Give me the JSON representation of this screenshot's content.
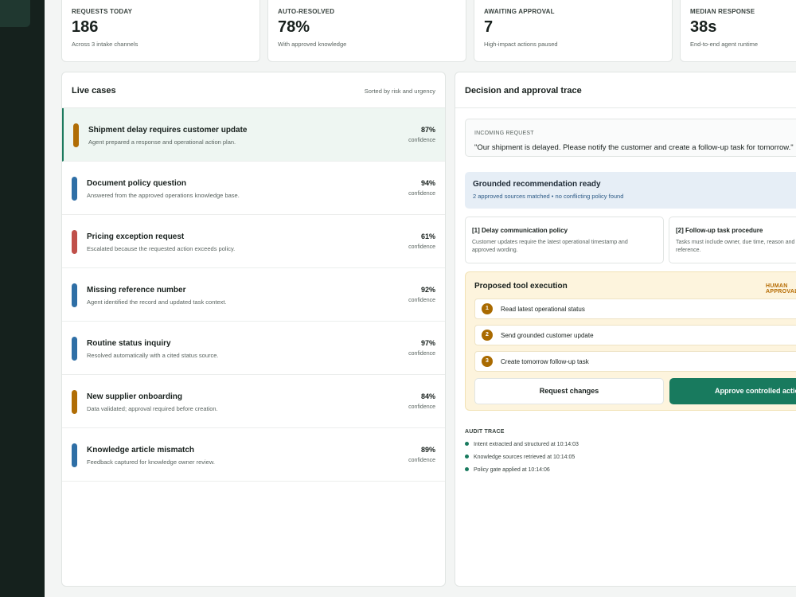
{
  "stats": [
    {
      "label": "REQUESTS TODAY",
      "value": "186",
      "sub": "Across 3 intake channels"
    },
    {
      "label": "AUTO-RESOLVED",
      "value": "78%",
      "sub": "With approved knowledge"
    },
    {
      "label": "AWAITING APPROVAL",
      "value": "7",
      "sub": "High-impact actions paused"
    },
    {
      "label": "MEDIAN RESPONSE",
      "value": "38s",
      "sub": "End-to-end agent runtime"
    }
  ],
  "cases_panel": {
    "title": "Live cases",
    "meta": "Sorted by risk and urgency",
    "items": [
      {
        "title": "Shipment delay requires customer update",
        "desc": "Agent prepared a response and operational action plan.",
        "pct": "87%",
        "conf": "confidence",
        "color": "#b06d05"
      },
      {
        "title": "Document policy question",
        "desc": "Answered from the approved operations knowledge base.",
        "pct": "94%",
        "conf": "confidence",
        "color": "#2f6fa6"
      },
      {
        "title": "Pricing exception request",
        "desc": "Escalated because the requested action exceeds policy.",
        "pct": "61%",
        "conf": "confidence",
        "color": "#c0504a"
      },
      {
        "title": "Missing reference number",
        "desc": "Agent identified the record and updated task context.",
        "pct": "92%",
        "conf": "confidence",
        "color": "#2f6fa6"
      },
      {
        "title": "Routine status inquiry",
        "desc": "Resolved automatically with a cited status source.",
        "pct": "97%",
        "conf": "confidence",
        "color": "#2f6fa6"
      },
      {
        "title": "New supplier onboarding",
        "desc": "Data validated; approval required before creation.",
        "pct": "84%",
        "conf": "confidence",
        "color": "#b06d05"
      },
      {
        "title": "Knowledge article mismatch",
        "desc": "Feedback captured for knowledge owner review.",
        "pct": "89%",
        "conf": "confidence",
        "color": "#2f6fa6"
      }
    ]
  },
  "trace_panel": {
    "title": "Decision and approval trace",
    "incoming_label": "INCOMING REQUEST",
    "incoming_text": "\"Our shipment is delayed. Please notify the customer and create a follow-up task for tomorrow.\"",
    "grounded_title": "Grounded recommendation ready",
    "grounded_sub": "2 approved sources matched • no conflicting policy found",
    "sources": [
      {
        "title": "[1] Delay communication policy",
        "desc": "Customer updates require the latest operational timestamp and\napproved wording."
      },
      {
        "title": "[2] Follow-up task procedure",
        "desc": "Tasks must include owner, due time, reason and\nreference."
      }
    ],
    "proposed_title": "Proposed tool execution",
    "proposed_badge": "HUMAN APPROVAL",
    "steps": [
      {
        "num": "1",
        "label": "Read latest operational status"
      },
      {
        "num": "2",
        "label": "Send grounded customer update"
      },
      {
        "num": "3",
        "label": "Create tomorrow follow-up task"
      }
    ],
    "request_changes_label": "Request changes",
    "approve_label": "Approve controlled action",
    "audit_label": "AUDIT TRACE",
    "audit": [
      "Intent extracted and structured at 10:14:03",
      "Knowledge sources retrieved at 10:14:05",
      "Policy gate applied at 10:14:06"
    ]
  },
  "colors": {
    "accent": "#187a5e",
    "sidebar": "#15211d",
    "warning": "#b56a00"
  }
}
